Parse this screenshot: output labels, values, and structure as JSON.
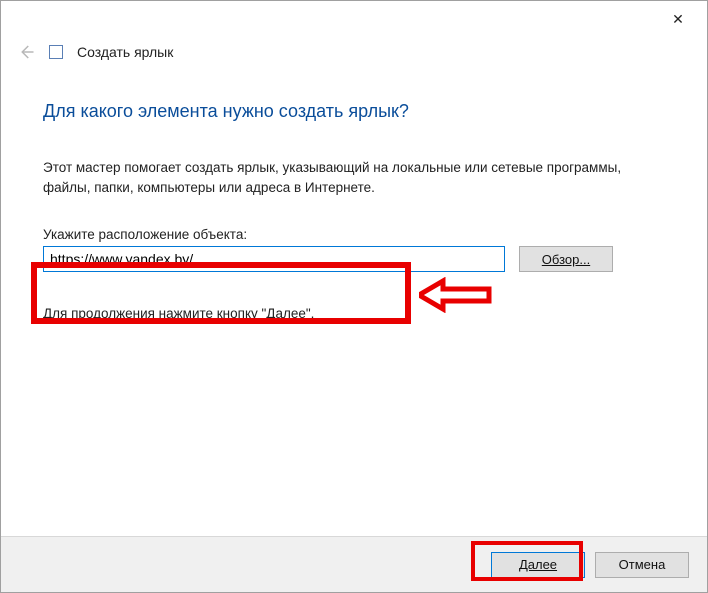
{
  "titlebar": {
    "close_glyph": "✕"
  },
  "header": {
    "title": "Создать ярлык"
  },
  "main": {
    "heading": "Для какого элемента нужно создать ярлык?",
    "description": "Этот мастер помогает создать ярлык, указывающий на локальные или сетевые программы, файлы, папки, компьютеры или адреса в Интернете.",
    "location_label": "Укажите расположение объекта:",
    "location_value": "https://www.yandex.by/",
    "browse_label": "Обзор...",
    "continue_text": "Для продолжения нажмите кнопку \"Далее\"."
  },
  "footer": {
    "next_label": "Далее",
    "cancel_label": "Отмена"
  }
}
